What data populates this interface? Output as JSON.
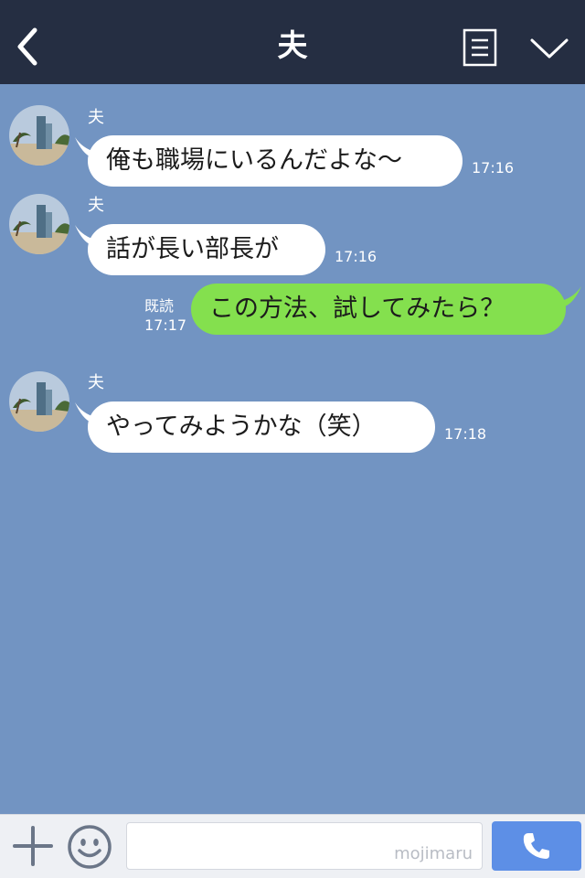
{
  "header": {
    "title": "夫",
    "back_icon": "chevron-left-icon",
    "notes_icon": "notes-icon",
    "menu_icon": "chevron-down-icon"
  },
  "messages": [
    {
      "direction": "incoming",
      "sender": "夫",
      "text": "俺も職場にいるんだよな〜",
      "time": "17:16"
    },
    {
      "direction": "incoming",
      "sender": "夫",
      "text": "話が長い部長が",
      "time": "17:16"
    },
    {
      "direction": "outgoing",
      "text": "この方法、試してみたら？",
      "read": "既読",
      "time": "17:17"
    },
    {
      "direction": "incoming",
      "sender": "夫",
      "text": "やってみようかな（笑）",
      "time": "17:18"
    }
  ],
  "footer": {
    "plus_icon": "plus-icon",
    "emoji_icon": "smiley-icon",
    "input_value": "",
    "watermark": "mojimaru",
    "call_icon": "phone-icon"
  },
  "colors": {
    "header_bg": "#252e42",
    "chat_bg": "#7294c2",
    "outgoing_bubble": "#84e04e",
    "incoming_bubble": "#ffffff",
    "call_button": "#5d8fe6"
  }
}
